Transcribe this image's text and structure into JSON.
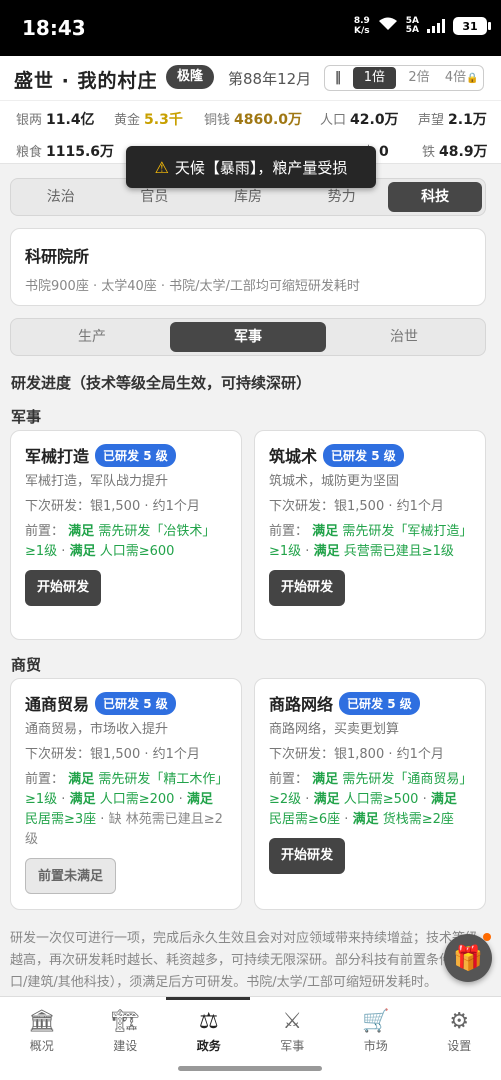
{
  "status_bar": {
    "time": "18:43",
    "net_speed_value": "8.9",
    "net_speed_unit": "K/s",
    "signal1": "5A",
    "signal2": "5A",
    "battery": "31"
  },
  "header": {
    "title": "盛世 · 我的村庄",
    "badge": "极隆",
    "turn": "第88年12月",
    "speed": {
      "pause": "‖",
      "options": [
        "1倍",
        "2倍",
        "4倍"
      ],
      "active": "1倍"
    }
  },
  "resources": [
    {
      "label": "银两",
      "value": "11.4亿"
    },
    {
      "label": "黄金",
      "value": "5.3千"
    },
    {
      "label": "铜钱",
      "value": "4860.0万"
    },
    {
      "label": "人口",
      "value": "42.0万"
    },
    {
      "label": "声望",
      "value": "2.1万"
    },
    {
      "label": "粮食",
      "value": "1115.6万"
    },
    {
      "label": "木",
      "value": "0"
    },
    {
      "label": "铁",
      "value": "48.9万"
    }
  ],
  "toast": {
    "icon": "warning-icon",
    "text": "天候【暴雨】，粮产量受损"
  },
  "main_tabs": {
    "items": [
      "法治",
      "官员",
      "库房",
      "势力",
      "科技"
    ],
    "active": "科技"
  },
  "academy": {
    "name": "科研院所",
    "desc": "书院900座 · 太学40座 · 书院/太学/工部均可缩短研发耗时"
  },
  "sub_tabs": {
    "items": [
      "生产",
      "军事",
      "治世"
    ],
    "active": "军事"
  },
  "section_title": "研发进度（技术等级全局生效，可持续深研）",
  "groups": [
    {
      "title": "军事",
      "cards": [
        {
          "name": "军械打造",
          "level": "已研发 5 级",
          "desc": "军械打造，军队战力提升",
          "next": "下次研发：银1,500 · 约1个月",
          "prereq_label": "前置：",
          "prereqs": [
            {
              "ok": true,
              "tag": "满足",
              "text": "需先研发「冶铁术」≥1级"
            },
            {
              "ok": true,
              "tag": "满足",
              "text": "人口需≥600"
            }
          ],
          "button": "开始研发",
          "button_disabled": false
        },
        {
          "name": "筑城术",
          "level": "已研发 5 级",
          "desc": "筑城术，城防更为坚固",
          "next": "下次研发：银1,500 · 约1个月",
          "prereq_label": "前置：",
          "prereqs": [
            {
              "ok": true,
              "tag": "满足",
              "text": "需先研发「军械打造」≥1级"
            },
            {
              "ok": true,
              "tag": "满足",
              "text": "兵营需已建且≥1级"
            }
          ],
          "button": "开始研发",
          "button_disabled": false
        }
      ]
    },
    {
      "title": "商贸",
      "cards": [
        {
          "name": "通商贸易",
          "level": "已研发 5 级",
          "desc": "通商贸易，市场收入提升",
          "next": "下次研发：银1,500 · 约1个月",
          "prereq_label": "前置：",
          "prereqs": [
            {
              "ok": true,
              "tag": "满足",
              "text": "需先研发「精工木作」≥1级"
            },
            {
              "ok": true,
              "tag": "满足",
              "text": "人口需≥200"
            },
            {
              "ok": true,
              "tag": "满足",
              "text": "民居需≥3座"
            },
            {
              "ok": false,
              "tag": "缺",
              "text": "林苑需已建且≥2级"
            }
          ],
          "button": "前置未满足",
          "button_disabled": true
        },
        {
          "name": "商路网络",
          "level": "已研发 5 级",
          "desc": "商路网络，买卖更划算",
          "next": "下次研发：银1,800 · 约1个月",
          "prereq_label": "前置：",
          "prereqs": [
            {
              "ok": true,
              "tag": "满足",
              "text": "需先研发「通商贸易」≥2级"
            },
            {
              "ok": true,
              "tag": "满足",
              "text": "人口需≥500"
            },
            {
              "ok": true,
              "tag": "满足",
              "text": "民居需≥6座"
            },
            {
              "ok": true,
              "tag": "满足",
              "text": "货栈需≥2座"
            }
          ],
          "button": "开始研发",
          "button_disabled": false
        }
      ]
    }
  ],
  "footnote": "研发一次仅可进行一项，完成后永久生效且会对对应领域带来持续增益；技术等级越高，再次研发耗时越长、耗资越多，可持续无限深研。部分科技有前置条件（人口/建筑/其他科技），须满足后方可研发。书院/太学/工部可缩短研发耗时。",
  "bottom_nav": {
    "items": [
      {
        "label": "概况",
        "icon": "temple-icon"
      },
      {
        "label": "建设",
        "icon": "crane-icon"
      },
      {
        "label": "政务",
        "icon": "scales-icon"
      },
      {
        "label": "军事",
        "icon": "swords-icon"
      },
      {
        "label": "市场",
        "icon": "cart-icon"
      },
      {
        "label": "设置",
        "icon": "gear-icon"
      }
    ],
    "active": "政务"
  },
  "colors": {
    "accent": "#2f6fe0",
    "dark_button": "#444444",
    "ok_green": "#22a34a",
    "gold": "#c8a000"
  }
}
